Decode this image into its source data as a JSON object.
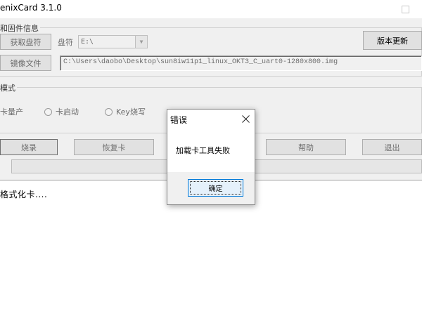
{
  "window": {
    "title": "enixCard 3.1.0"
  },
  "device_group": {
    "title": "和固件信息",
    "get_drive_button": "获取盘符",
    "drive_label": "盘符",
    "drive_value": "E:\\",
    "version_update_button": "版本更新",
    "image_file_button": "镜像文件",
    "image_path": "C:\\Users\\daobo\\Desktop\\sun8iw11p1_linux_OKT3_C_uart0-1280x800.img"
  },
  "mode_group": {
    "title": "模式",
    "options": [
      "卡量产",
      "卡启动",
      "Key烧写"
    ]
  },
  "actions": {
    "burn_button": "烧录",
    "restore_button": "恢复卡",
    "help_button": "帮助",
    "exit_button": "退出"
  },
  "log": {
    "line1": "格式化卡...."
  },
  "dialog": {
    "title": "错误",
    "message": "加载卡工具失败",
    "ok_button": "确定"
  },
  "colors": {
    "accent": "#0078d7",
    "window_bg": "#f0f0f0",
    "disabled_text": "#6d6d6d"
  }
}
